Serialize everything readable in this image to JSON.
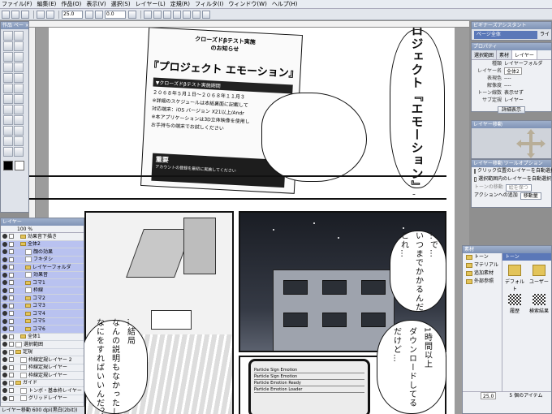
{
  "menu": [
    "ファイル(F)",
    "編集(E)",
    "作品(O)",
    "表示(V)",
    "選択(S)",
    "レイヤー(L)",
    "定規(R)",
    "フィルタ(I)",
    "ウィンドウ(W)",
    "ヘルプ(H)"
  ],
  "toolbar": {
    "zoom": "25.0",
    "angle": "0.0"
  },
  "tool_panel": {
    "title": "作品 ペー ×"
  },
  "assistant": {
    "title": "ビギナーズアシスタント",
    "page_all": "ページ全体",
    "extra": "ライ"
  },
  "properties": {
    "title": "プロパティ",
    "tabs": [
      "選択範囲",
      "素材",
      "レイヤー"
    ],
    "rows": [
      {
        "k": "種類",
        "v": "レイヤーフォルダ"
      },
      {
        "k": "レイヤー名",
        "v": "全体2"
      },
      {
        "k": "表現色",
        "v": "----"
      },
      {
        "k": "解像度",
        "v": "----"
      },
      {
        "k": "トーン線数",
        "v": "表示せず"
      },
      {
        "k": "サブ定規",
        "v": "レイヤー"
      }
    ],
    "detail_button": "詳細表示"
  },
  "navigator": {
    "title": "レイヤー移動"
  },
  "move_options": {
    "title": "レイヤー移動 ツールオプション",
    "opt1": "クリック位置のレイヤーを自動選択",
    "opt2": "選択範囲内のレイヤーを自動選択",
    "opt3": "トーンの移動",
    "opt3_value": "絵を保つ",
    "action_label": "アクションへの追加",
    "action_value": "移動量"
  },
  "materials": {
    "title": "素材",
    "tree": [
      "トーン",
      "マテリアル",
      "追加素材",
      "外部参照"
    ],
    "header": "トーン",
    "cells": [
      "デフォルト",
      "ユーザー",
      "履歴",
      "検索結果"
    ],
    "footer_zoom": "25.0",
    "count": "5 個のアイテム"
  },
  "layers": {
    "title": "レイヤー",
    "opacity": "100 %",
    "rows": [
      {
        "name": "効果音下描き",
        "type": "folder",
        "depth": 1,
        "sel": false
      },
      {
        "name": "全体2",
        "type": "folder",
        "depth": 1,
        "sel": true
      },
      {
        "name": "顔の効果",
        "type": "layer",
        "depth": 2,
        "sel": true
      },
      {
        "name": "フキダシ",
        "type": "layer",
        "depth": 2,
        "sel": true
      },
      {
        "name": "レイヤーフォルダ",
        "type": "folder",
        "depth": 2,
        "sel": true
      },
      {
        "name": "効果音",
        "type": "layer",
        "depth": 2,
        "sel": true
      },
      {
        "name": "コマ1",
        "type": "folder",
        "depth": 2,
        "sel": true
      },
      {
        "name": "枠線",
        "type": "layer",
        "depth": 2,
        "sel": true
      },
      {
        "name": "コマ2",
        "type": "folder",
        "depth": 2,
        "sel": true
      },
      {
        "name": "コマ3",
        "type": "folder",
        "depth": 2,
        "sel": true
      },
      {
        "name": "コマ4",
        "type": "folder",
        "depth": 2,
        "sel": true
      },
      {
        "name": "コマ5",
        "type": "folder",
        "depth": 2,
        "sel": true
      },
      {
        "name": "コマ6",
        "type": "folder",
        "depth": 2,
        "sel": true
      },
      {
        "name": "全体1",
        "type": "folder",
        "depth": 1,
        "sel": false
      },
      {
        "name": "選択範囲",
        "type": "layer",
        "depth": 0,
        "sel": false
      },
      {
        "name": "定規",
        "type": "folder",
        "depth": 0,
        "sel": false
      },
      {
        "name": "枠線定規レイヤー 2",
        "type": "layer",
        "depth": 1,
        "sel": false
      },
      {
        "name": "枠線定規レイヤー",
        "type": "layer",
        "depth": 1,
        "sel": false
      },
      {
        "name": "枠線定規レイヤー",
        "type": "layer",
        "depth": 1,
        "sel": false
      },
      {
        "name": "ガイド",
        "type": "folder",
        "depth": 0,
        "sel": false
      },
      {
        "name": "トンボ・基本枠レイヤー",
        "type": "layer",
        "depth": 1,
        "sel": false
      },
      {
        "name": "グリッドレイヤー",
        "type": "layer",
        "depth": 1,
        "sel": false
      }
    ]
  },
  "status": "レイヤー移動 600 dpi(黒白(2bit))",
  "manga": {
    "flyer_head1": "クローズドβテスト実施",
    "flyer_head2": "のお知らせ",
    "flyer_title": "『プロジェクト エモーション』",
    "flyer_bar": "▼クローズドβテスト実施期間",
    "flyer_line1": "２０６８年５月１日〜２０６８年１１月３",
    "flyer_line2": "※詳細のスケジュールは本紙裏面に記載して",
    "flyer_line3": "対応端末：iOS バージョン X21以上/Andr",
    "flyer_line4": "※本アプリケーションは3D立体映像を使用し",
    "flyer_line5": "お手持ちの端末でお試しください",
    "flyer_important": "重要",
    "flyer_important_sub": "アカウントの登録を最初に実施してください",
    "bubble_top": "―プロジェクト『エモーション』…？",
    "bubble_wait1": "…で…",
    "bubble_wait2": "いつまでかかるんだ",
    "bubble_wait3": "これ…",
    "bubble_dl1": "1時間以上",
    "bubble_dl2": "ダウンロードしてる",
    "bubble_dl3": "だけど…",
    "bubble_left1": "…結局",
    "bubble_left2": "なんの説明もなかったし",
    "bubble_left3": "なにをすればいいんだ？",
    "phone_lines": [
      "Particle Sign Emotion",
      "Particle Sign Emotion",
      "Particle Emotion Ready",
      "Particle Emotion Loader"
    ]
  }
}
